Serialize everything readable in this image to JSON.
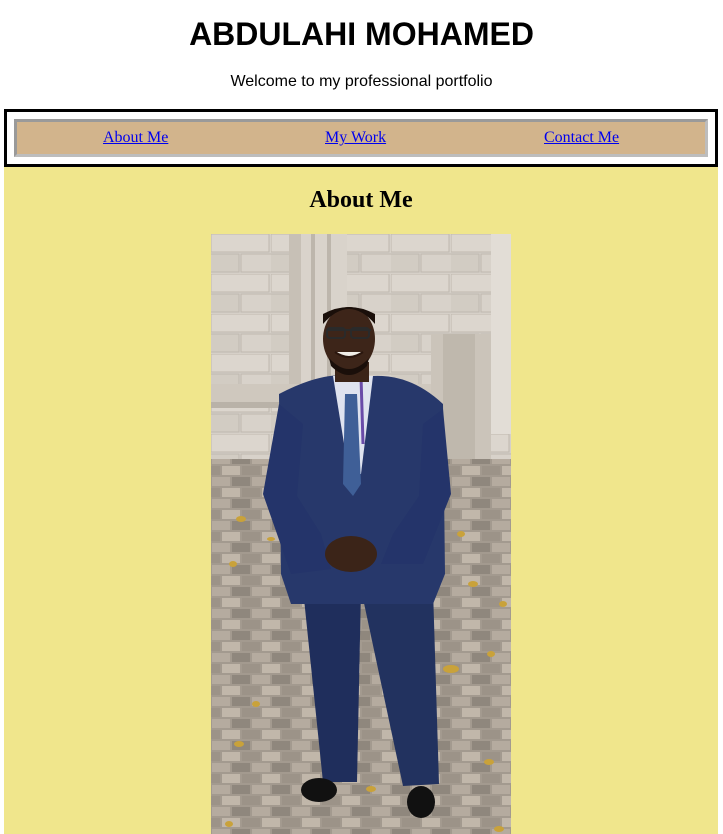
{
  "header": {
    "title": "ABDULAHI MOHAMED",
    "tagline": "Welcome to my professional portfolio"
  },
  "nav": {
    "items": [
      {
        "label": "About Me"
      },
      {
        "label": "My Work"
      },
      {
        "label": "Contact Me"
      }
    ]
  },
  "about": {
    "heading": "About Me",
    "photo_alt": "Photo of Abdulahi Mohamed"
  },
  "colors": {
    "nav_background": "#d2b48c",
    "main_background": "#f0e68c",
    "link": "#0000ee"
  }
}
